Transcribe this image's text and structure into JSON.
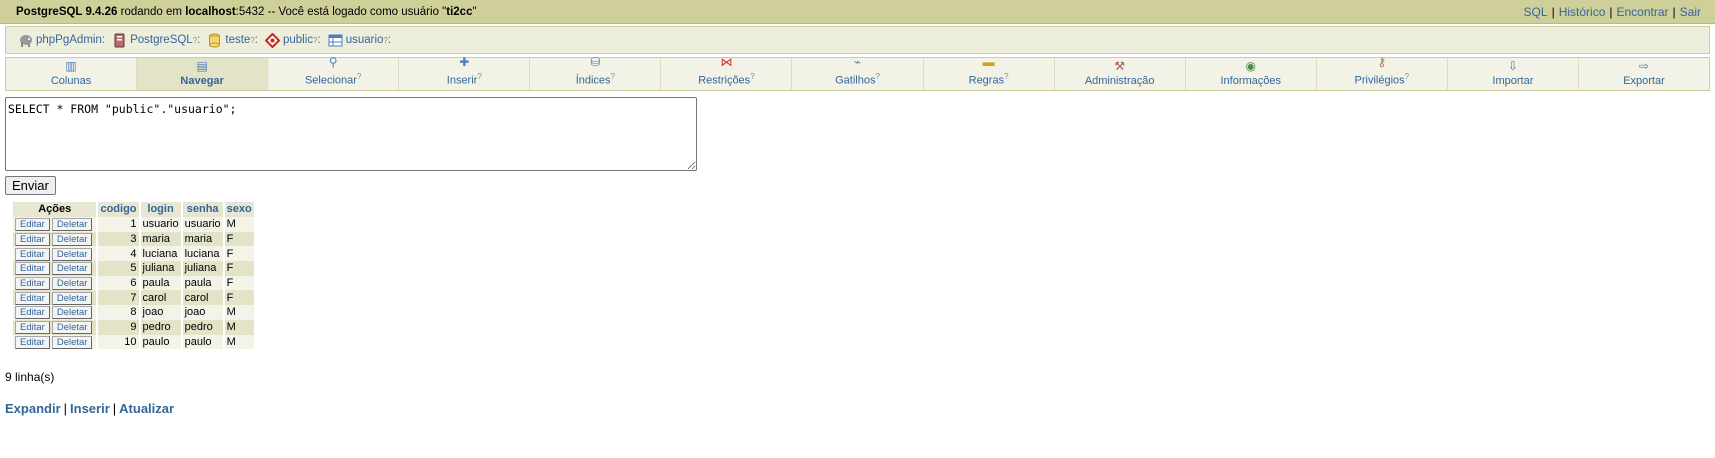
{
  "topbar": {
    "server_name": "PostgreSQL 9.4.26",
    "running_on": " rodando em ",
    "host": "localhost",
    "port_text": ":5432 -- Você está logado como usuário \"",
    "user": "ti2cc",
    "end_quote": "\"",
    "links": [
      "SQL",
      "Histórico",
      "Encontrar",
      "Sair"
    ]
  },
  "trail": [
    {
      "label": "phpPgAdmin",
      "icon": "elephant-icon",
      "q": ""
    },
    {
      "label": "PostgreSQL",
      "icon": "server-icon",
      "q": "?"
    },
    {
      "label": "teste",
      "icon": "database-icon",
      "q": "?"
    },
    {
      "label": "public",
      "icon": "schema-icon",
      "q": "?"
    },
    {
      "label": "usuario",
      "icon": "table-icon",
      "q": "?"
    }
  ],
  "tabs": [
    {
      "label": "Colunas",
      "icon": "columns-icon",
      "q": ""
    },
    {
      "label": "Navegar",
      "icon": "browse-icon",
      "q": "",
      "active": true
    },
    {
      "label": "Selecionar",
      "icon": "search-icon",
      "q": "?"
    },
    {
      "label": "Inserir",
      "icon": "plus-icon",
      "q": "?"
    },
    {
      "label": "Índices",
      "icon": "indexes-icon",
      "q": "?"
    },
    {
      "label": "Restrições",
      "icon": "constraints-icon",
      "q": "?"
    },
    {
      "label": "Gatilhos",
      "icon": "triggers-icon",
      "q": "?"
    },
    {
      "label": "Regras",
      "icon": "rules-icon",
      "q": "?"
    },
    {
      "label": "Administração",
      "icon": "admin-icon",
      "q": ""
    },
    {
      "label": "Informações",
      "icon": "info-icon",
      "q": ""
    },
    {
      "label": "Privilégios",
      "icon": "privileges-icon",
      "q": "?"
    },
    {
      "label": "Importar",
      "icon": "import-icon",
      "q": ""
    },
    {
      "label": "Exportar",
      "icon": "export-icon",
      "q": ""
    }
  ],
  "query": {
    "sql": "SELECT * FROM \"public\".\"usuario\";",
    "submit_label": "Enviar"
  },
  "results": {
    "actions_header": "Ações",
    "columns": [
      "codigo",
      "login",
      "senha",
      "sexo"
    ],
    "edit_label": "Editar",
    "delete_label": "Deletar",
    "rows": [
      [
        "1",
        "usuario",
        "usuario",
        "M"
      ],
      [
        "3",
        "maria",
        "maria",
        "F"
      ],
      [
        "4",
        "luciana",
        "luciana",
        "F"
      ],
      [
        "5",
        "juliana",
        "juliana",
        "F"
      ],
      [
        "6",
        "paula",
        "paula",
        "F"
      ],
      [
        "7",
        "carol",
        "carol",
        "F"
      ],
      [
        "8",
        "joao",
        "joao",
        "M"
      ],
      [
        "9",
        "pedro",
        "pedro",
        "M"
      ],
      [
        "10",
        "paulo",
        "paulo",
        "M"
      ]
    ],
    "row_count_text": "9 linha(s)"
  },
  "bottom_links": [
    "Expandir",
    "Inserir",
    "Atualizar"
  ],
  "colors": {
    "topbar_bg": "#cfcf9a",
    "link": "#336699",
    "row_odd": "#f3f3e9",
    "row_even": "#e3e3c7"
  }
}
